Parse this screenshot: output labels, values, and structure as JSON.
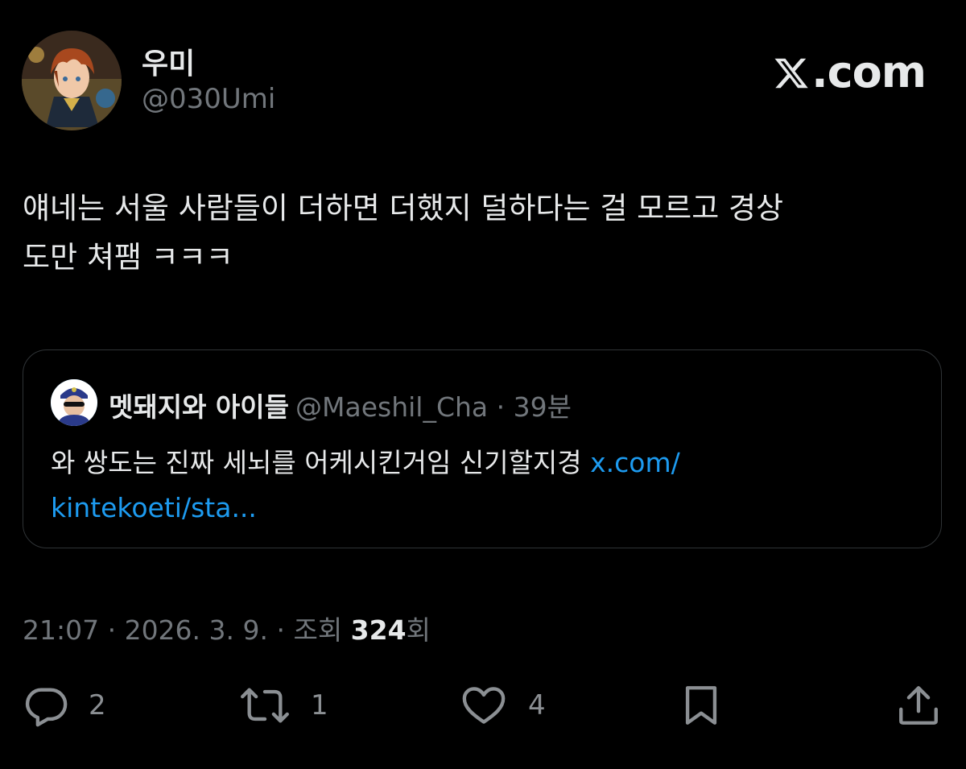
{
  "author": {
    "display_name": "우미",
    "handle": "@030Umi"
  },
  "brand": {
    "label": ".com"
  },
  "tweet": {
    "text_line1": "얘네는 서울 사람들이 더하면 더했지 덜하다는 걸 모르고 경상",
    "text_line2": "도만 쳐팸 ㅋㅋㅋ"
  },
  "quote": {
    "name": "멧돼지와 아이들",
    "meta": "@Maeshil_Cha · 39분",
    "text": "와 쌍도는 진짜 세뇌를 어케시킨거임 신기할지경 ",
    "link_part1": "x.com/",
    "link_part2": "kintekoeti/sta..."
  },
  "meta": {
    "time_date": "21:07 · 2026. 3. 9. · 조회 ",
    "views": "324",
    "views_unit": "회"
  },
  "actions": {
    "reply_count": "2",
    "retweet_count": "1",
    "like_count": "4"
  },
  "colors": {
    "background": "#000000",
    "text_primary": "#e7e9ea",
    "text_secondary": "#71767b",
    "link": "#1d9bf0",
    "border": "#2f3336"
  },
  "icons": [
    "x-logo-icon",
    "reply-icon",
    "retweet-icon",
    "like-icon",
    "bookmark-icon",
    "share-icon"
  ]
}
